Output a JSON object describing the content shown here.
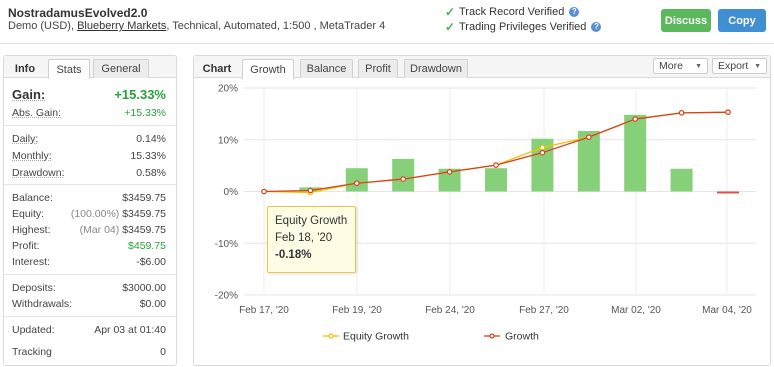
{
  "header": {
    "account_name": "NostradamusEvolved2.0",
    "meta_prefix": "Demo (USD),",
    "broker": "Blueberry Markets",
    "meta_suffix": ", Technical, Automated, 1:500 , MetaTrader 4",
    "verif_track": "Track Record Verified",
    "verif_trading": "Trading Privileges Verified",
    "check_icon": "✓",
    "help_icon": "?",
    "discuss_label": "Discuss",
    "copy_label": "Copy",
    "colors": {
      "discuss": "#5cb85c",
      "copy": "#3f8fd2",
      "check": "#4caf50"
    }
  },
  "left_panel": {
    "tabs": {
      "title": "Info",
      "stats": "Stats",
      "general": "General"
    },
    "gain_label": "Gain:",
    "gain_value": "+15.33%",
    "abs_gain_label": "Abs. Gain:",
    "abs_gain_value": "+15.33%",
    "daily_label": "Daily:",
    "daily_value": "0.14%",
    "monthly_label": "Monthly:",
    "monthly_value": "15.33%",
    "drawdown_label": "Drawdown:",
    "drawdown_value": "0.58%",
    "balance_label": "Balance:",
    "balance_value": "$3459.75",
    "equity_label": "Equity:",
    "equity_note": "(100.00%)",
    "equity_value": "$3459.75",
    "highest_label": "Highest:",
    "highest_note": "(Mar 04)",
    "highest_value": "$3459.75",
    "profit_label": "Profit:",
    "profit_value": "$459.75",
    "interest_label": "Interest:",
    "interest_value": "-$6.00",
    "deposits_label": "Deposits:",
    "deposits_value": "$3000.00",
    "withdrawals_label": "Withdrawals:",
    "withdrawals_value": "$0.00",
    "updated_label": "Updated:",
    "updated_value": "Apr 03 at 01:40",
    "tracking_label": "Tracking",
    "tracking_value": "0"
  },
  "chart_panel": {
    "tabs": {
      "title": "Chart",
      "growth": "Growth",
      "balance": "Balance",
      "profit": "Profit",
      "drawdown": "Drawdown"
    },
    "more_label": "More",
    "export_label": "Export",
    "caret_icon": "▼",
    "tooltip": {
      "title": "Equity Growth",
      "date": "Feb 18, '20",
      "value": "-0.18%"
    }
  },
  "chart_data": {
    "type": "bar",
    "x_ticks": [
      "Feb 17, '20",
      "Feb 19, '20",
      "Feb 24, '20",
      "Feb 27, '20",
      "Mar 02, '20",
      "Mar 04, '20"
    ],
    "y_ticks": [
      "20%",
      "10%",
      "0%",
      "-10%",
      "-20%"
    ],
    "ylim": [
      -20,
      20
    ],
    "grid": true,
    "legend_position": "bottom",
    "bar_values": [
      0,
      0.8,
      4.5,
      6.3,
      4.4,
      4.5,
      10.2,
      11.7,
      14.8,
      4.4,
      -0.3
    ],
    "series": [
      {
        "name": "Equity Growth",
        "values": [
          0,
          -0.18,
          1.6,
          2.4,
          3.8,
          5.1,
          8.5,
          10.5,
          14.0,
          15.2,
          15.3
        ],
        "color": "#f2c200"
      },
      {
        "name": "Growth",
        "values": [
          0,
          0.2,
          1.6,
          2.4,
          3.8,
          5.1,
          7.5,
          10.5,
          14.0,
          15.2,
          15.33
        ],
        "color": "#d9401e"
      }
    ],
    "colors": {
      "bar_positive": "#86d07a",
      "bar_negative": "#e05050"
    }
  }
}
